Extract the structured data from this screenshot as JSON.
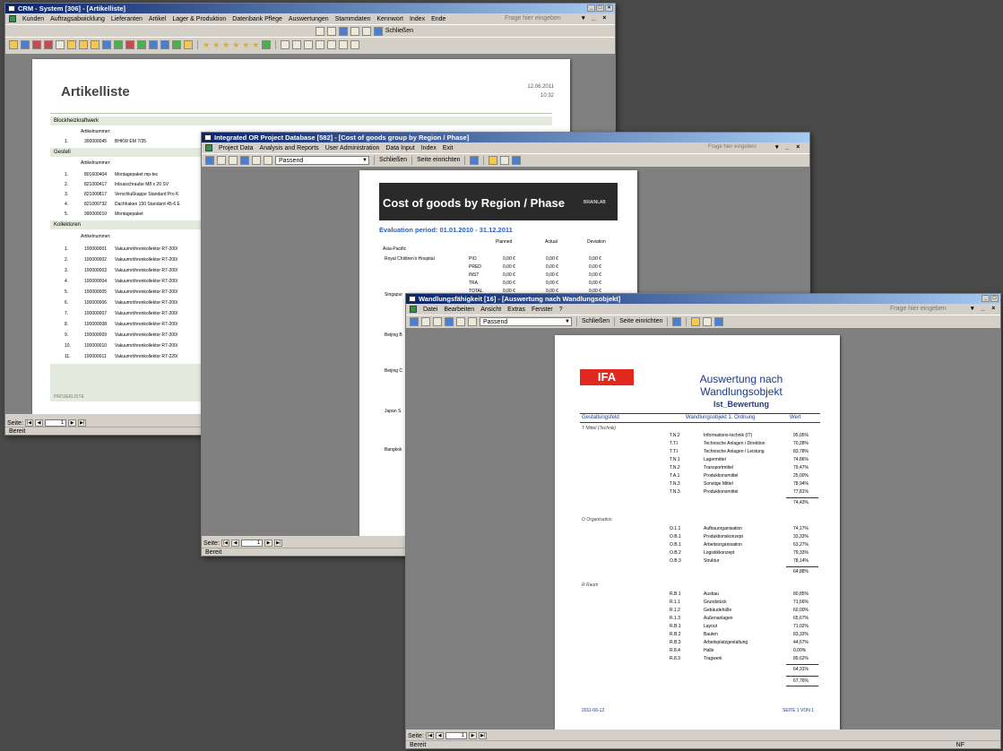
{
  "crm": {
    "title": "CRM - System [306] - [Artikelliste]",
    "menu": [
      "Kunden",
      "Auftragsabwicklung",
      "Lieferanten",
      "Artikel",
      "Lager & Produktion",
      "Datenbank Pflege",
      "Auswertungen",
      "Stammdaten",
      "Kennwort",
      "Index",
      "Ende"
    ],
    "ask": "Frage hier eingeben",
    "toolbar_close": "Schließen",
    "report_title": "Artikelliste",
    "date": "12.06.2011",
    "time": "10:32",
    "groups": [
      {
        "name": "Blockheizkraftwerk",
        "header": "Artikelnummer:",
        "rows": [
          {
            "n": "1.",
            "nr": "300000045",
            "txt": "BHKW EM 7/35"
          }
        ]
      },
      {
        "name": "Gestell",
        "header": "Artikelnummer:",
        "rows": [
          {
            "n": "1.",
            "nr": "801600404",
            "txt": "Montagepaket mp-tec"
          },
          {
            "n": "2.",
            "nr": "821000417",
            "txt": "Inbusschraube M8 x 20 SV"
          },
          {
            "n": "3.",
            "nr": "821000817",
            "txt": "Verschlußkappe Standard Pro K"
          },
          {
            "n": "4.",
            "nr": "821000732",
            "txt": "Dachhaken 150 Standard 45-6 E"
          },
          {
            "n": "5.",
            "nr": "990000010",
            "txt": "Montagepaket"
          }
        ]
      },
      {
        "name": "Kollektoren",
        "header": "Artikelnummer:",
        "rows": [
          {
            "n": "1.",
            "nr": "100000001",
            "txt": "Vakuumröhrenkollektor R7-200/"
          },
          {
            "n": "2.",
            "nr": "100000002",
            "txt": "Vakuumröhrenkollektor R7-200/"
          },
          {
            "n": "3.",
            "nr": "100000003",
            "txt": "Vakuumröhrenkollektor R7-200/"
          },
          {
            "n": "4.",
            "nr": "100000004",
            "txt": "Vakuumröhrenkollektor R7-200/"
          },
          {
            "n": "5.",
            "nr": "100000005",
            "txt": "Vakuumröhrenkollektor R7-200/"
          },
          {
            "n": "6.",
            "nr": "100000006",
            "txt": "Vakuumröhrenkollektor R7-200/"
          },
          {
            "n": "7.",
            "nr": "100000007",
            "txt": "Vakuumröhrenkollektor R7-200/"
          },
          {
            "n": "8.",
            "nr": "100000008",
            "txt": "Vakuumröhrenkollektor R7-200/"
          },
          {
            "n": "9.",
            "nr": "100000009",
            "txt": "Vakuumröhrenkollektor R7-200/"
          },
          {
            "n": "10.",
            "nr": "100000010",
            "txt": "Vakuumröhrenkollektor R7-200/"
          },
          {
            "n": "11.",
            "nr": "100000011",
            "txt": "Vakuumröhrenkollektor R7-220/"
          }
        ]
      }
    ],
    "page_label": "Seite:",
    "page_num": "1",
    "status": "Bereit",
    "footer": "PROJEKLISTE"
  },
  "ior": {
    "title": "Integrated OR Project Database [582] - [Cost of goods group by Region / Phase]",
    "menu": [
      "Project Data",
      "Analysis and Reports",
      "User Administration",
      "Data Input",
      "Index",
      "Exit"
    ],
    "ask": "Frage hier eingeben",
    "zoom": "Passend",
    "close": "Schließen",
    "page_setup": "Seite einrichten",
    "report_title": "Cost of goods by Region / Phase",
    "brand": "BRAINLAB",
    "period": "Evaluation period: 01.01.2010 - 31.12.2011",
    "cols": [
      "Planned",
      "Actual",
      "Deviation"
    ],
    "region": "Asia-Pacific",
    "customer": "Royal Children's Hospital",
    "rows": [
      {
        "phase": "PIO",
        "p": "0,00 €",
        "a": "0,00 €",
        "d": "0,00 €"
      },
      {
        "phase": "PRED",
        "p": "0,00 €",
        "a": "0,00 €",
        "d": "0,00 €"
      },
      {
        "phase": "INST",
        "p": "0,00 €",
        "a": "0,00 €",
        "d": "0,00 €"
      },
      {
        "phase": "TRA",
        "p": "0,00 €",
        "a": "0,00 €",
        "d": "0,00 €"
      },
      {
        "phase": "TOTAL",
        "p": "0,00 €",
        "a": "0,00 €",
        "d": "0,00 €"
      }
    ],
    "side_labels": [
      "Singapur",
      "Beijing B",
      "Beijing C",
      "Japan S",
      "Bangkok"
    ],
    "page_label": "Seite:",
    "page_num": "1",
    "status": "Bereit"
  },
  "wf": {
    "title": "Wandlungsfähigkeit [16] - [Auswertung nach Wandlungsobjekt]",
    "menu": [
      "Datei",
      "Bearbeiten",
      "Ansicht",
      "Extras",
      "Fenster",
      "?"
    ],
    "ask": "Frage hier eingeben",
    "zoom": "Passend",
    "close": "Schließen",
    "page_setup": "Seite einrichten",
    "logo": "IFA",
    "report_title_1": "Auswertung nach",
    "report_title_2": "Wandlungsobjekt",
    "subtitle": "Ist_Bewertung",
    "col1": "Gestaltungsfeld",
    "col2": "Wandlungsobjekt 1. Ordnung",
    "col3": "Wert",
    "sections": [
      {
        "name": "T  Mittel (Technik)",
        "rows": [
          {
            "code": "T.N.2",
            "txt": "Informations-technik (IT)",
            "val": "95,05%"
          },
          {
            "code": "T.T.I",
            "txt": "Technische Anlagen / Direktion",
            "val": "70,28%"
          },
          {
            "code": "T.T.I",
            "txt": "Technische Anlagen / Leistung",
            "val": "83,78%"
          },
          {
            "code": "T.N.1",
            "txt": "Lagermittel",
            "val": "74,86%"
          },
          {
            "code": "T.N.2",
            "txt": "Transportmittel",
            "val": "79,47%"
          },
          {
            "code": "T.A.1",
            "txt": "Produktionsmittel",
            "val": "25,00%"
          },
          {
            "code": "T.N.3",
            "txt": "Sonstige Mittel",
            "val": "78,94%"
          },
          {
            "code": "T.N.3",
            "txt": "Produktionsmittel",
            "val": "77,81%"
          }
        ],
        "total": "74,43%"
      },
      {
        "name": "O  Organisation",
        "rows": [
          {
            "code": "O.1.1",
            "txt": "Aufbauorganisation",
            "val": "74,17%"
          },
          {
            "code": "O.B.1",
            "txt": "Produktionskonzept",
            "val": "33,33%"
          },
          {
            "code": "O.B.1",
            "txt": "Arbeitsorganisation",
            "val": "63,27%"
          },
          {
            "code": "O.B.2",
            "txt": "Logistikkonzept",
            "val": "79,33%"
          },
          {
            "code": "O.B.3",
            "txt": "Struktur",
            "val": "78,14%"
          }
        ],
        "total": "64,88%"
      },
      {
        "name": "R  Raum",
        "rows": [
          {
            "code": "R.B.1",
            "txt": "Ausbau",
            "val": "80,85%"
          },
          {
            "code": "R.1.1",
            "txt": "Grundstück",
            "val": "71,66%"
          },
          {
            "code": "R.1.2",
            "txt": "Gebäudehülle",
            "val": "60,00%"
          },
          {
            "code": "R.1.3",
            "txt": "Außenanlagen",
            "val": "65,67%"
          },
          {
            "code": "R.B.1",
            "txt": "Layout",
            "val": "71,02%"
          },
          {
            "code": "R.B.2",
            "txt": "Bauten",
            "val": "83,33%"
          },
          {
            "code": "R.B.3",
            "txt": "Arbeitsplatzgestaltung",
            "val": "44,67%"
          },
          {
            "code": "R.8.4",
            "txt": "Halle",
            "val": "0,00%"
          },
          {
            "code": "R.8.3",
            "txt": "Tragwerk",
            "val": "89,62%"
          }
        ],
        "total": "64,31%"
      }
    ],
    "grand_total": "67,76%",
    "footer_date": "2011-06-12",
    "footer_page": "SEITE 1 VON 1",
    "page_label": "Seite:",
    "page_num": "1",
    "status": "Bereit",
    "status_right": "NF"
  }
}
